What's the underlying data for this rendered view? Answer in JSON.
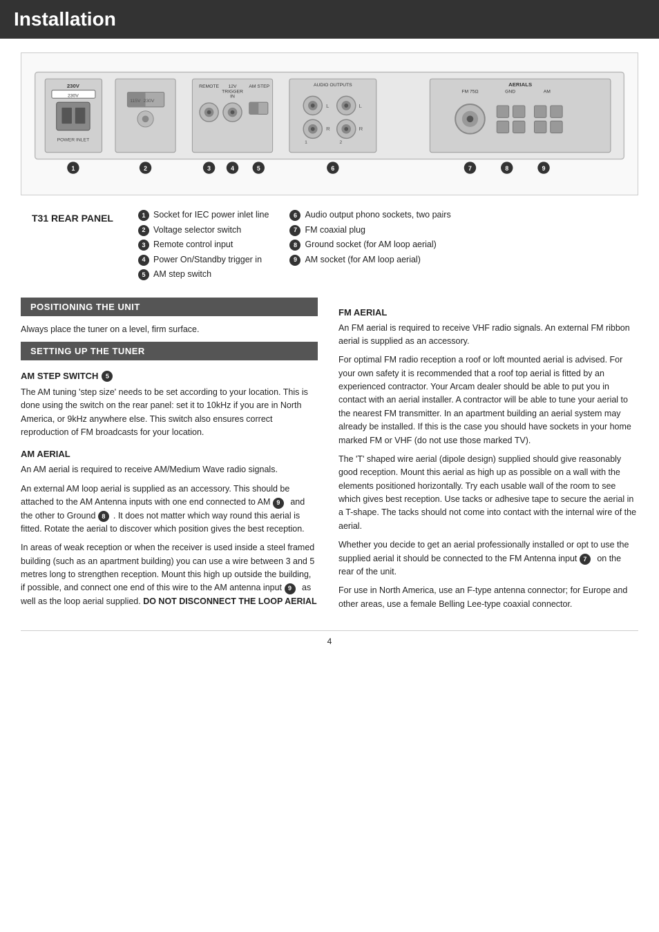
{
  "header": {
    "title": "Installation"
  },
  "rear_panel": {
    "title": "T31 REAR PANEL",
    "items_left": [
      {
        "num": "1",
        "text": "Socket for IEC power inlet line"
      },
      {
        "num": "2",
        "text": "Voltage selector switch"
      },
      {
        "num": "3",
        "text": "Remote control input"
      },
      {
        "num": "4",
        "text": "Power On/Standby trigger in"
      },
      {
        "num": "5",
        "text": "AM step switch"
      }
    ],
    "items_right": [
      {
        "num": "6",
        "text": "Audio output phono sockets, two pairs"
      },
      {
        "num": "7",
        "text": "FM coaxial plug"
      },
      {
        "num": "8",
        "text": "Ground socket (for AM loop aerial)"
      },
      {
        "num": "9",
        "text": "AM socket (for AM loop aerial)"
      }
    ]
  },
  "positioning": {
    "header": "POSITIONING THE UNIT",
    "body": "Always place the tuner on a level, firm surface."
  },
  "setting_up": {
    "header": "SETTING UP THE TUNER",
    "am_step": {
      "header": "AM STEP SWITCH",
      "num": "5",
      "body1": "The AM tuning 'step size' needs to be set according to your location. This is done using the switch on the rear panel: set it to 10kHz if you are in North America, or 9kHz anywhere else. This switch also ensures correct reproduction of FM broadcasts for your location."
    },
    "am_aerial_left": {
      "header": "AM AERIAL",
      "body1": "An AM aerial is required to receive AM/Medium Wave radio signals.",
      "body2": "An external AM loop aerial is supplied as an accessory. This should be attached to the AM Antenna inputs with one end connected to AM",
      "num9": "9",
      "body3": "and the other to Ground",
      "num8": "8",
      "body4": ". It does not matter which way round this aerial is fitted. Rotate the aerial to discover which position gives the best reception.",
      "body5": "In areas of weak reception or when the receiver is used inside a steel framed building (such as an apartment building) you can use a wire between 3 and 5 metres long to strengthen reception. Mount this high up outside the building, if possible, and connect one end of this wire to the AM antenna input",
      "num9b": "9",
      "body6": "as well as the loop aerial supplied.",
      "bold": "DO NOT DISCONNECT THE LOOP AERIAL"
    }
  },
  "fm_aerial": {
    "header": "FM AERIAL",
    "body1": "An FM aerial is required to receive VHF radio signals. An external FM ribbon aerial is supplied as an accessory.",
    "body2": "For optimal FM radio reception a roof or loft mounted aerial is advised. For your own safety it is recommended that a roof top aerial is fitted by an experienced contractor. Your Arcam dealer should be able to put you in contact with an aerial installer. A contractor will be able to tune your aerial to the nearest FM transmitter. In an apartment building an aerial system may already be installed. If this is the case you should have sockets in your home marked FM or VHF (do not use those marked TV).",
    "body3": "The 'T' shaped wire aerial (dipole design) supplied should give reasonably good reception. Mount this aerial as high up as possible on a wall with the elements positioned horizontally. Try each usable wall of the room to see which gives best reception. Use tacks or adhesive tape to secure the aerial in a T-shape. The tacks should not come into contact with the internal wire of the aerial.",
    "body4": "Whether you decide to get an aerial professionally installed or opt to use the supplied aerial it should be connected to the FM Antenna input",
    "num7": "7",
    "body4b": "on the rear of the unit.",
    "body5": "For use in North America, use an F-type antenna connector; for Europe and other areas, use a female Belling Lee-type coaxial connector."
  },
  "page_number": "4"
}
